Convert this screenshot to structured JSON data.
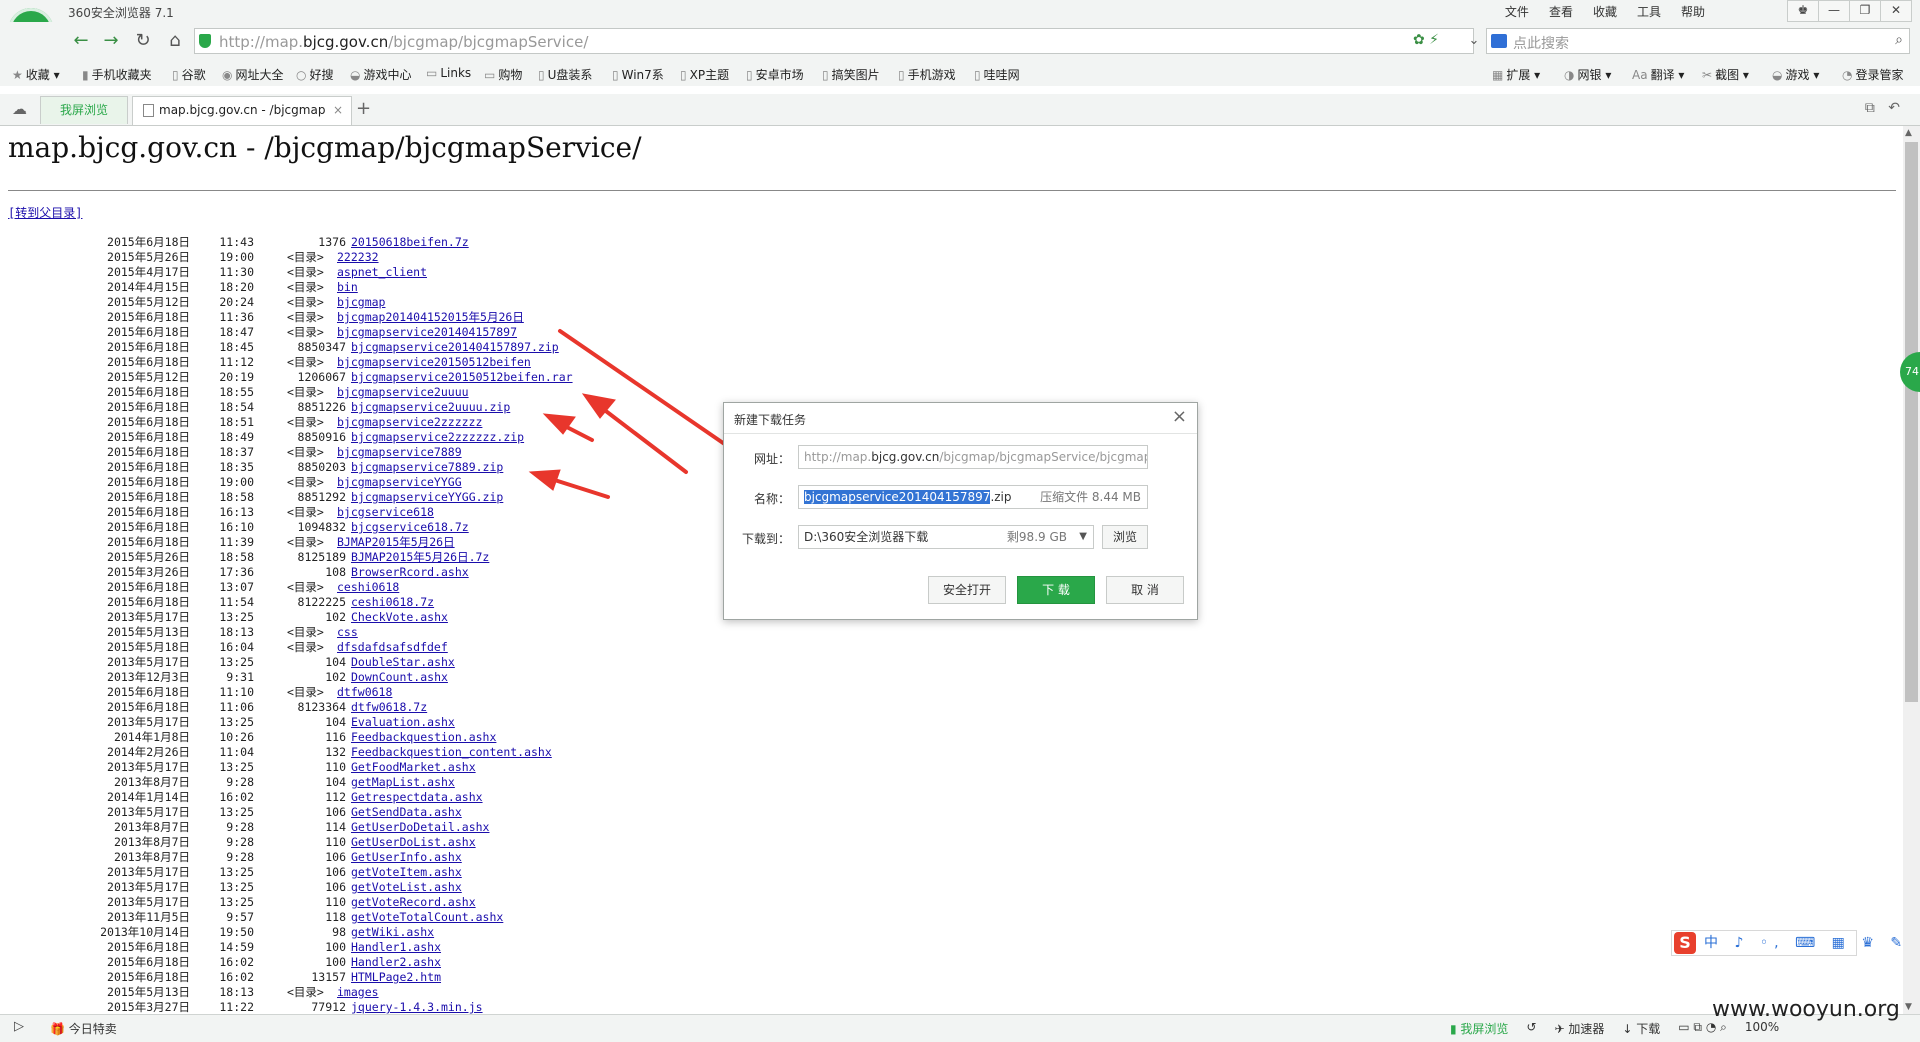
{
  "window": {
    "title": "360安全浏览器 7.1",
    "menu": [
      "文件",
      "查看",
      "收藏",
      "工具",
      "帮助"
    ]
  },
  "nav": {
    "url_prefix": "http://map.",
    "url_host": "bjcg.gov.cn",
    "url_path": "/bjcgmap/bjcgmapService/",
    "search_placeholder": "点此搜索"
  },
  "bookmarks": [
    "收藏",
    "手机收藏夹",
    "谷歌",
    "网址大全",
    "好搜",
    "游戏中心",
    "Links",
    "购物",
    "U盘装系",
    "Win7系",
    "XP主题",
    "安卓市场",
    "搞笑图片",
    "手机游戏",
    "哇哇网"
  ],
  "toolbar_right": [
    "扩展",
    "网银",
    "翻译",
    "截图",
    "游戏",
    "登录管家"
  ],
  "tabs": {
    "split_label": "我屏浏览",
    "active_label": "map.bjcg.gov.cn - /bjcgmap"
  },
  "page": {
    "title": "map.bjcg.gov.cn - /bjcgmap/bjcgmapService/",
    "parent_link": "[转到父目录]"
  },
  "dir_label": "<目录>",
  "listing": [
    {
      "date": "2015年6月18日",
      "time": "11:43",
      "size": "1376",
      "name": "20150618beifen.7z"
    },
    {
      "date": "2015年5月26日",
      "time": "19:00",
      "dir": true,
      "name": "222232"
    },
    {
      "date": "2015年4月17日",
      "time": "11:30",
      "dir": true,
      "name": "aspnet_client"
    },
    {
      "date": "2014年4月15日",
      "time": "18:20",
      "dir": true,
      "name": "bin"
    },
    {
      "date": "2015年5月12日",
      "time": "20:24",
      "dir": true,
      "name": "bjcgmap"
    },
    {
      "date": "2015年6月18日",
      "time": "11:36",
      "dir": true,
      "name": "bjcgmap201404152015年5月26日"
    },
    {
      "date": "2015年6月18日",
      "time": "18:47",
      "dir": true,
      "name": "bjcgmapservice201404157897"
    },
    {
      "date": "2015年6月18日",
      "time": "18:45",
      "size": "8850347",
      "name": "bjcgmapservice201404157897.zip"
    },
    {
      "date": "2015年6月18日",
      "time": "11:12",
      "dir": true,
      "name": "bjcgmapservice20150512beifen"
    },
    {
      "date": "2015年5月12日",
      "time": "20:19",
      "size": "1206067",
      "name": "bjcgmapservice20150512beifen.rar"
    },
    {
      "date": "2015年6月18日",
      "time": "18:55",
      "dir": true,
      "name": "bjcgmapservice2uuuu"
    },
    {
      "date": "2015年6月18日",
      "time": "18:54",
      "size": "8851226",
      "name": "bjcgmapservice2uuuu.zip"
    },
    {
      "date": "2015年6月18日",
      "time": "18:51",
      "dir": true,
      "name": "bjcgmapservice2zzzzzz"
    },
    {
      "date": "2015年6月18日",
      "time": "18:49",
      "size": "8850916",
      "name": "bjcgmapservice2zzzzzz.zip"
    },
    {
      "date": "2015年6月18日",
      "time": "18:37",
      "dir": true,
      "name": "bjcgmapservice7889"
    },
    {
      "date": "2015年6月18日",
      "time": "18:35",
      "size": "8850203",
      "name": "bjcgmapservice7889.zip"
    },
    {
      "date": "2015年6月18日",
      "time": "19:00",
      "dir": true,
      "name": "bjcgmapserviceYYGG"
    },
    {
      "date": "2015年6月18日",
      "time": "18:58",
      "size": "8851292",
      "name": "bjcgmapserviceYYGG.zip"
    },
    {
      "date": "2015年6月18日",
      "time": "16:13",
      "dir": true,
      "name": "bjcgservice618"
    },
    {
      "date": "2015年6月18日",
      "time": "16:10",
      "size": "1094832",
      "name": "bjcgservice618.7z"
    },
    {
      "date": "2015年6月18日",
      "time": "11:39",
      "dir": true,
      "name": "BJMAP2015年5月26日"
    },
    {
      "date": "2015年5月26日",
      "time": "18:58",
      "size": "8125189",
      "name": "BJMAP2015年5月26日.7z"
    },
    {
      "date": "2015年3月26日",
      "time": "17:36",
      "size": "108",
      "name": "BrowserRcord.ashx"
    },
    {
      "date": "2015年6月18日",
      "time": "13:07",
      "dir": true,
      "name": "ceshi0618"
    },
    {
      "date": "2015年6月18日",
      "time": "11:54",
      "size": "8122225",
      "name": "ceshi0618.7z"
    },
    {
      "date": "2013年5月17日",
      "time": "13:25",
      "size": "102",
      "name": "CheckVote.ashx"
    },
    {
      "date": "2015年5月13日",
      "time": "18:13",
      "dir": true,
      "name": "css"
    },
    {
      "date": "2015年5月18日",
      "time": "16:04",
      "dir": true,
      "name": "dfsdafdsafsdfdef"
    },
    {
      "date": "2013年5月17日",
      "time": "13:25",
      "size": "104",
      "name": "DoubleStar.ashx"
    },
    {
      "date": "2013年12月3日",
      "time": "9:31",
      "size": "102",
      "name": "DownCount.ashx"
    },
    {
      "date": "2015年6月18日",
      "time": "11:10",
      "dir": true,
      "name": "dtfw0618"
    },
    {
      "date": "2015年6月18日",
      "time": "11:06",
      "size": "8123364",
      "name": "dtfw0618.7z"
    },
    {
      "date": "2013年5月17日",
      "time": "13:25",
      "size": "104",
      "name": "Evaluation.ashx"
    },
    {
      "date": "2014年1月8日",
      "time": "10:26",
      "size": "116",
      "name": "Feedbackquestion.ashx"
    },
    {
      "date": "2014年2月26日",
      "time": "11:04",
      "size": "132",
      "name": "Feedbackquestion_content.ashx"
    },
    {
      "date": "2013年5月17日",
      "time": "13:25",
      "size": "110",
      "name": "GetFoodMarket.ashx"
    },
    {
      "date": "2013年8月7日",
      "time": "9:28",
      "size": "104",
      "name": "getMapList.ashx"
    },
    {
      "date": "2014年1月14日",
      "time": "16:02",
      "size": "112",
      "name": "Getrespectdata.ashx"
    },
    {
      "date": "2013年5月17日",
      "time": "13:25",
      "size": "106",
      "name": "GetSendData.ashx"
    },
    {
      "date": "2013年8月7日",
      "time": "9:28",
      "size": "114",
      "name": "GetUserDoDetail.ashx"
    },
    {
      "date": "2013年8月7日",
      "time": "9:28",
      "size": "110",
      "name": "GetUserDoList.ashx"
    },
    {
      "date": "2013年8月7日",
      "time": "9:28",
      "size": "106",
      "name": "GetUserInfo.ashx"
    },
    {
      "date": "2013年5月17日",
      "time": "13:25",
      "size": "106",
      "name": "getVoteItem.ashx"
    },
    {
      "date": "2013年5月17日",
      "time": "13:25",
      "size": "106",
      "name": "getVoteList.ashx"
    },
    {
      "date": "2013年5月17日",
      "time": "13:25",
      "size": "110",
      "name": "getVoteRecord.ashx"
    },
    {
      "date": "2013年11月5日",
      "time": "9:57",
      "size": "118",
      "name": "getVoteTotalCount.ashx"
    },
    {
      "date": "2013年10月14日",
      "time": "19:50",
      "size": "98",
      "name": "getWiki.ashx"
    },
    {
      "date": "2015年6月18日",
      "time": "14:59",
      "size": "100",
      "name": "Handler1.ashx"
    },
    {
      "date": "2015年6月18日",
      "time": "16:02",
      "size": "100",
      "name": "Handler2.ashx"
    },
    {
      "date": "2015年6月18日",
      "time": "16:02",
      "size": "13157",
      "name": "HTMLPage2.htm"
    },
    {
      "date": "2015年5月13日",
      "time": "18:13",
      "dir": true,
      "name": "images"
    },
    {
      "date": "2015年3月27日",
      "time": "11:22",
      "size": "77912",
      "name": "jquery-1.4.3.min.js"
    }
  ],
  "dialog": {
    "title": "新建下载任务",
    "url_label": "网址：",
    "url_prefix": "http://map.",
    "url_host": "bjcg.gov.cn",
    "url_path": "/bjcgmap/bjcgmapService/bjcgmap",
    "name_label": "名称：",
    "name_selected": "bjcgmapservice201404157897",
    "name_ext": ".zip",
    "name_meta": "压缩文件 8.44 MB",
    "path_label": "下载到：",
    "path_value": "D:\\360安全浏览器下载",
    "path_meta": "剩98.9 GB",
    "browse_label": "浏览",
    "open_label": "安全打开",
    "download_label": "下 载",
    "cancel_label": "取 消"
  },
  "side_badge": "74",
  "ime": {
    "logo": "S",
    "items": "中 ♪ ◦, ⌨ ▦ ♛ ✎"
  },
  "status": {
    "deals": "今日特卖",
    "split": "我屏浏览",
    "accelerator": "加速器",
    "download": "下载",
    "zoom": "100%"
  },
  "watermark": "www.wooyun.org",
  "colors": {
    "accent": "#2aa84a",
    "link": "#1a0dab",
    "arrow": "#e8362c",
    "selection": "#3374d4"
  }
}
